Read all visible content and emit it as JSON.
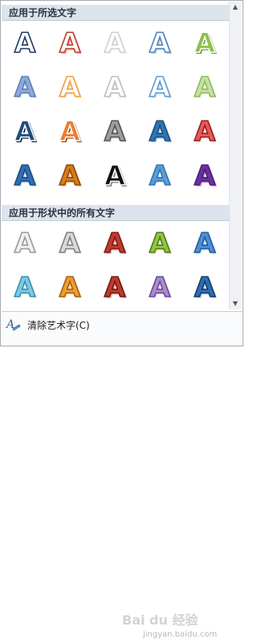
{
  "sections": [
    {
      "title": "应用于所选文字"
    },
    {
      "title": "应用于形状中的所有文字"
    }
  ],
  "wordart_glyph": "A",
  "footer": {
    "clear_label": "清除艺术字(C)",
    "clear_icon": "clear-wordart-icon"
  },
  "watermark": {
    "text": "Bai du 经验",
    "url": "jingyan.baidu.com"
  },
  "scrollbar": {
    "up": "▲",
    "down": "▼"
  },
  "styles": [
    [
      "#ffffff",
      "#1f3864",
      "#ffffff"
    ],
    [
      "#ffffff",
      "#c0392b",
      "#f4b7b0"
    ],
    [
      "#ffffff",
      "#d0d0d0",
      "#f5f5f5"
    ],
    [
      "#ffffff",
      "#4d82b8",
      "#c9dcf0"
    ],
    [
      "#8fbf4b",
      "#ffffff",
      "#6a9e2a"
    ],
    [
      "#8ea9db",
      "#5b7fb8",
      "#dbe5f5"
    ],
    [
      "#ffffff",
      "#f39c3b",
      "#fde2c3"
    ],
    [
      "#ffffff",
      "#bfbfbf",
      "#eeeeee"
    ],
    [
      "#ffffff",
      "#5b9bd5",
      "#d6e6f6"
    ],
    [
      "#c6e0a5",
      "#8dbb5a",
      "#eef7e0"
    ],
    [
      "#1f4e79",
      "#ffffff",
      "#0b2540"
    ],
    [
      "#ed7d31",
      "#ffffff",
      "#9c4710"
    ],
    [
      "#9e9e9e",
      "#555555",
      "#e0e0e0"
    ],
    [
      "#2e75b6",
      "#1f4e79",
      "#9dc3e6"
    ],
    [
      "#e35b5b",
      "#9c1c1c",
      "#f8d7d7"
    ],
    [
      "#2f6db5",
      "#1f4e79",
      "#c9dcf0"
    ],
    [
      "#d97a1a",
      "#8a4a0c",
      "#f5c99a"
    ],
    [
      "#111111",
      "#ffffff",
      "#777777"
    ],
    [
      "#5b9bd5",
      "#2e75b6",
      "#ffffff"
    ],
    [
      "#6b2fa3",
      "#4a1f73",
      "#c5a8e0"
    ],
    [
      "#f0f0f0",
      "#9a9a9a",
      "#ffffff"
    ],
    [
      "#d9d9d9",
      "#808080",
      "#f7f7f7"
    ],
    [
      "#c0392b",
      "#7b1f17",
      "#f2b5ab"
    ],
    [
      "#8fc63f",
      "#4f7a1e",
      "#dff0c6"
    ],
    [
      "#4a90d9",
      "#245c99",
      "#d1e5fa"
    ],
    [
      "#7ec8e3",
      "#3b8fb0",
      "#e6f6fc"
    ],
    [
      "#f29b30",
      "#a35f12",
      "#ffe0b8"
    ],
    [
      "#c0392b",
      "#6e1a13",
      "#e8b0a8"
    ],
    [
      "#a98bd0",
      "#6a4a96",
      "#ece2f7"
    ],
    [
      "#2f6db5",
      "#163b66",
      "#b8d1ee"
    ]
  ]
}
